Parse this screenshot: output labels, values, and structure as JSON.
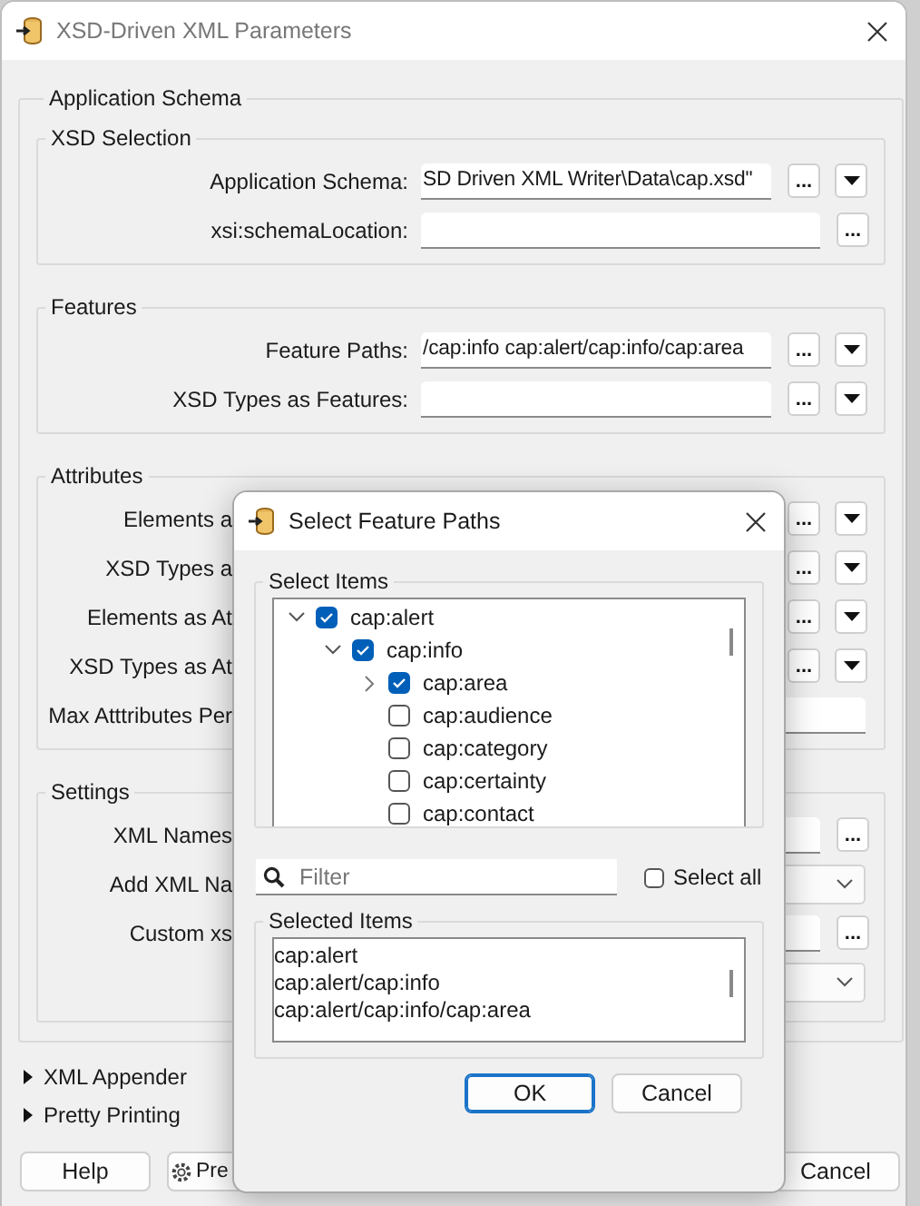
{
  "window": {
    "title": "XSD-Driven XML Parameters"
  },
  "main_section": {
    "title": "Application Schema",
    "groups": [
      {
        "title": "XSD Selection",
        "rows": [
          {
            "label": "Application Schema:",
            "kind": "field-browse-menu",
            "value": "SD Driven XML Writer\\Data\\cap.xsd\"",
            "browse": "..."
          },
          {
            "label": "xsi:schemaLocation:",
            "kind": "field-browse",
            "value": "",
            "browse": "..."
          }
        ]
      },
      {
        "title": "Features",
        "rows": [
          {
            "label": "Feature Paths:",
            "kind": "field-browse-menu",
            "value": "/cap:info cap:alert/cap:info/cap:area",
            "browse": "..."
          },
          {
            "label": "XSD Types as Features:",
            "kind": "field-browse-menu",
            "value": "",
            "browse": "..."
          }
        ]
      },
      {
        "title": "Attributes",
        "rows": [
          {
            "label": "Elements a",
            "kind": "browse-menu",
            "browse": "..."
          },
          {
            "label": "XSD Types a",
            "kind": "browse-menu",
            "browse": "..."
          },
          {
            "label": "Elements as At",
            "kind": "browse-menu",
            "browse": "..."
          },
          {
            "label": "XSD Types as At",
            "kind": "browse-menu",
            "browse": "..."
          },
          {
            "label": "Max Atttributes Per",
            "kind": "field"
          }
        ]
      },
      {
        "title": "Settings",
        "rows": [
          {
            "label": "XML Names",
            "kind": "field-browse",
            "value": "",
            "browse": "..."
          },
          {
            "label": "Add XML Na",
            "kind": "combo"
          },
          {
            "label": "Custom xs",
            "kind": "field-browse",
            "value": "",
            "browse": "..."
          },
          {
            "kind": "combo"
          }
        ]
      }
    ]
  },
  "collapsed_sections": [
    {
      "title": "XML Appender",
      "expanded": false
    },
    {
      "title": "Pretty Printing",
      "expanded": false
    }
  ],
  "footer_buttons": [
    {
      "label": "Help",
      "kind": "plain"
    },
    {
      "label": "Pre",
      "kind": "presets"
    },
    {
      "label": "Cancel",
      "kind": "cancel"
    }
  ],
  "dialog": {
    "title": "Select Feature Paths",
    "select_items": {
      "title": "Select Items",
      "tree": [
        {
          "label": "cap:alert",
          "checked": true,
          "expanded": true,
          "children": [
            {
              "label": "cap:info",
              "checked": true,
              "expanded": true,
              "children": [
                {
                  "label": "cap:area",
                  "checked": true,
                  "expanded": false
                },
                {
                  "label": "cap:audience",
                  "checked": false
                },
                {
                  "label": "cap:category",
                  "checked": false
                },
                {
                  "label": "cap:certainty",
                  "checked": false
                },
                {
                  "label": "cap:contact",
                  "checked": false
                }
              ]
            }
          ]
        }
      ]
    },
    "filter": {
      "placeholder": "Filter"
    },
    "select_all": {
      "label": "Select all",
      "checked": false
    },
    "selected_items": {
      "title": "Selected Items",
      "items": [
        "cap:alert",
        "cap:alert/cap:info",
        "cap:alert/cap:info/cap:area"
      ]
    },
    "buttons": [
      {
        "label": "OK",
        "selected": true
      },
      {
        "label": "Cancel",
        "selected": false
      }
    ]
  }
}
